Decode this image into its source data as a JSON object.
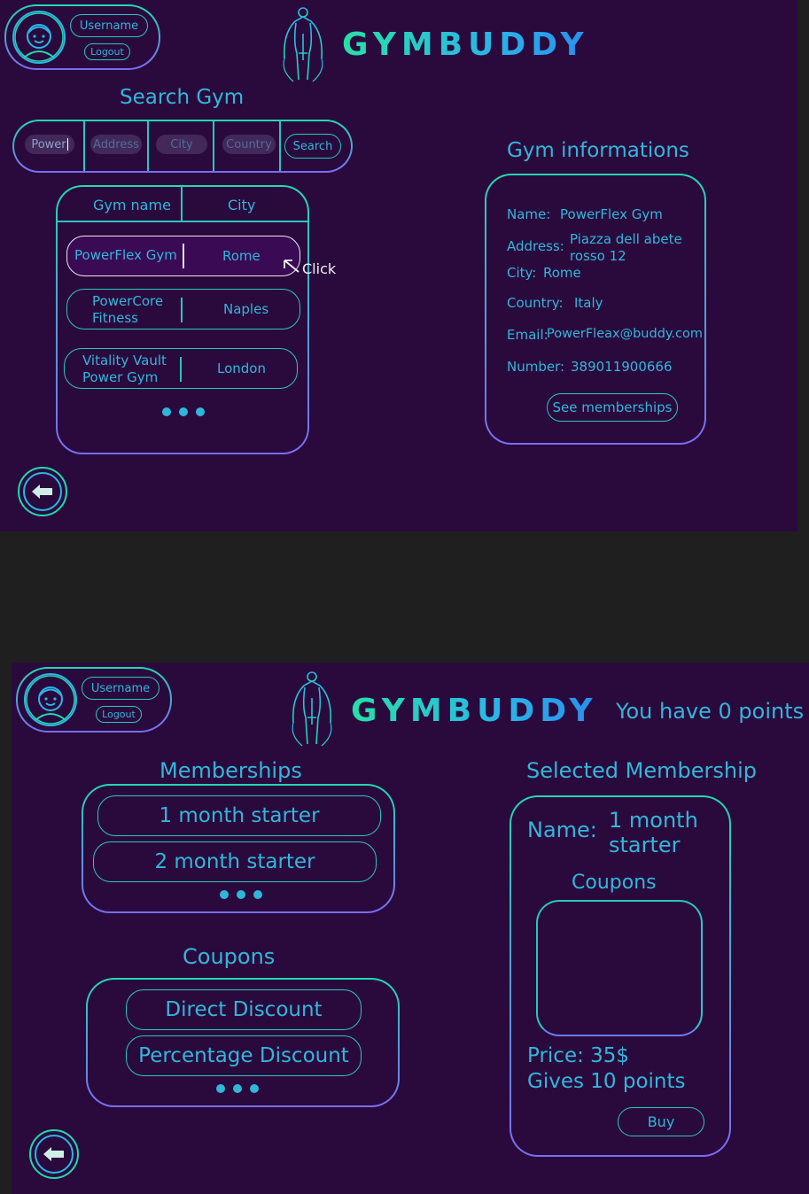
{
  "screen1": {
    "user": {
      "username": "Username",
      "logout": "Logout"
    },
    "logo": "GYMBUDDY",
    "search_title": "Search Gym",
    "search_fields": [
      {
        "value": "Power",
        "placeholder": ""
      },
      {
        "value": "",
        "placeholder": "Address"
      },
      {
        "value": "",
        "placeholder": "City"
      },
      {
        "value": "",
        "placeholder": "Country"
      }
    ],
    "search_button": "Search",
    "table": {
      "headers": [
        "Gym name",
        "City"
      ],
      "rows": [
        {
          "name": "PowerFlex Gym",
          "city": "Rome"
        },
        {
          "name": "PowerCore Fitness",
          "city": "Naples"
        },
        {
          "name": "Vitality Vault Power Gym",
          "city": "London"
        }
      ]
    },
    "click_label": "Click",
    "info": {
      "title": "Gym informations",
      "name_label": "Name:",
      "name_value": "PowerFlex Gym",
      "address_label": "Address:",
      "address_value": "Piazza dell abete rosso 12",
      "city_label": "City:",
      "city_value": "Rome",
      "country_label": "Country:",
      "country_value": "Italy",
      "email_label": "Email:",
      "email_value": "PowerFleax@buddy.com",
      "number_label": "Number:",
      "number_value": "389011900666",
      "memberships_button": "See memberships"
    }
  },
  "screen2": {
    "user": {
      "username": "Username",
      "logout": "Logout"
    },
    "logo": "GYMBUDDY",
    "points_text": "You have 0 points",
    "memberships_title": "Memberships",
    "memberships": [
      "1 month starter",
      "2 month starter"
    ],
    "coupons_title": "Coupons",
    "coupons": [
      "Direct Discount",
      "Percentage Discount"
    ],
    "selected": {
      "title": "Selected Membership",
      "name_label": "Name:",
      "name_value": "1 month starter",
      "coupons_title": "Coupons",
      "price": "Price: 35$",
      "points": "Gives 10 points",
      "buy": "Buy"
    }
  },
  "colors": {
    "background": "#2a0a3d",
    "accent": "#29c6c0",
    "text": "#33b6d8",
    "gradient_end": "#7a6cf2"
  }
}
